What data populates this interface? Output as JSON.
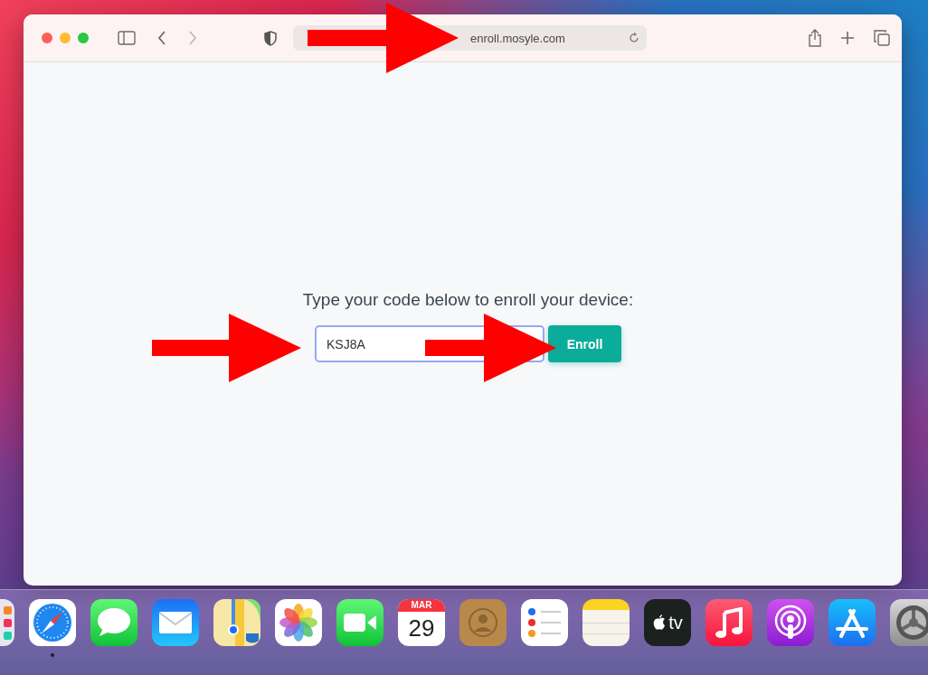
{
  "browser": {
    "url": "enroll.mosyle.com"
  },
  "page": {
    "prompt": "Type your code below to enroll your device:",
    "code_field": {
      "value": "KSJ8A",
      "focused": true
    },
    "button": "Enroll"
  },
  "annotations": [
    {
      "kind": "arrow"
    },
    {
      "kind": "arrow"
    },
    {
      "kind": "arrow"
    }
  ],
  "dock": [
    {
      "kind": "launchpad"
    },
    {
      "kind": "safari",
      "running": true
    },
    {
      "kind": "messages"
    },
    {
      "kind": "mail"
    },
    {
      "kind": "maps"
    },
    {
      "kind": "photos"
    },
    {
      "kind": "facetime"
    },
    {
      "kind": "calendar",
      "month": "MAR",
      "day": "29"
    },
    {
      "kind": "contacts"
    },
    {
      "kind": "reminders"
    },
    {
      "kind": "notes"
    },
    {
      "kind": "tv",
      "label": "tv"
    },
    {
      "kind": "music"
    },
    {
      "kind": "podcasts"
    },
    {
      "kind": "appstore"
    },
    {
      "kind": "settings"
    }
  ]
}
